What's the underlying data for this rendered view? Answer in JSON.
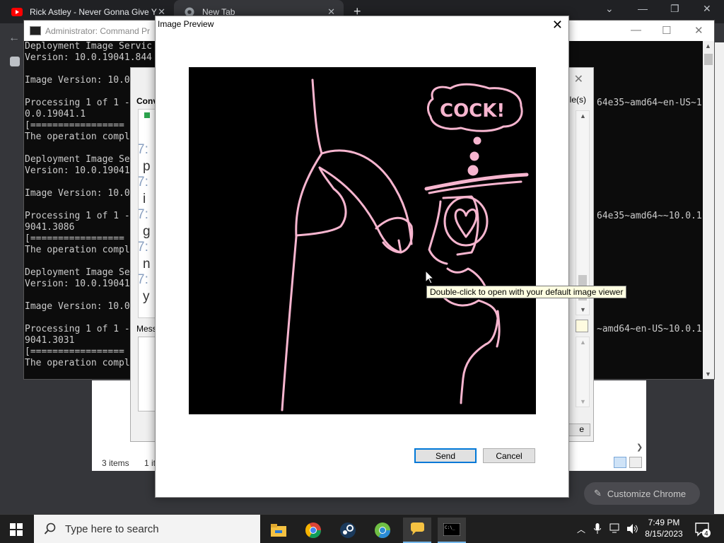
{
  "chrome": {
    "tabs": [
      {
        "title": "Rick Astley - Never Gonna Give Y",
        "icon": "youtube-icon"
      },
      {
        "title": "New Tab",
        "icon": "chrome-icon"
      }
    ],
    "customize_label": "Customize Chrome",
    "colors": {
      "tabbar": "#202124",
      "toolbar": "#35363a"
    }
  },
  "cmd": {
    "title": "Administrator: Command Pr",
    "lines": [
      "Deployment Image Servic",
      "Version: 10.0.19041.844",
      "",
      "Image Version: 10.0",
      "",
      "Processing 1 of 1 -",
      "0.0.19041.1",
      "[=================",
      "The operation compl",
      "",
      "Deployment Image Se",
      "Version: 10.0.19041",
      "",
      "Image Version: 10.0",
      "",
      "Processing 1 of 1 -",
      "9041.3086",
      "[=================",
      "The operation compl",
      "",
      "Deployment Image Se",
      "Version: 10.0.19041",
      "",
      "Image Version: 10.0",
      "",
      "Processing 1 of 1 -",
      "9041.3031",
      "[=================",
      "The operation compl"
    ],
    "right_lines": [
      {
        "row": 5,
        "text": "64e35~amd64~en-US~1"
      },
      {
        "row": 15,
        "text": "64e35~amd64~~10.0.1"
      },
      {
        "row": 25,
        "text": "~amd64~en-US~10.0.1"
      }
    ]
  },
  "mid_dialog": {
    "conv_label": "Conv",
    "files_label": "ile(s)",
    "mess_label": "Mess",
    "button_label": "e",
    "chat": [
      {
        "time": "7:",
        "word": "p"
      },
      {
        "time": "7:",
        "word": "i"
      },
      {
        "time": "7:",
        "word": "g"
      },
      {
        "time": "7:",
        "word": "n"
      },
      {
        "time": "7:",
        "word": "y"
      }
    ]
  },
  "explorer": {
    "status_items": "3 items",
    "status_selected": "1 it"
  },
  "preview": {
    "title": "Image Preview",
    "send_label": "Send",
    "cancel_label": "Cancel",
    "tooltip": "Double-click to open with your default image viewer",
    "drawing_text": "COCK!",
    "stroke_color": "#f7b5cf"
  },
  "taskbar": {
    "search_placeholder": "Type here to search",
    "time": "7:49 PM",
    "date": "8/15/2023",
    "notification_count": "4"
  }
}
